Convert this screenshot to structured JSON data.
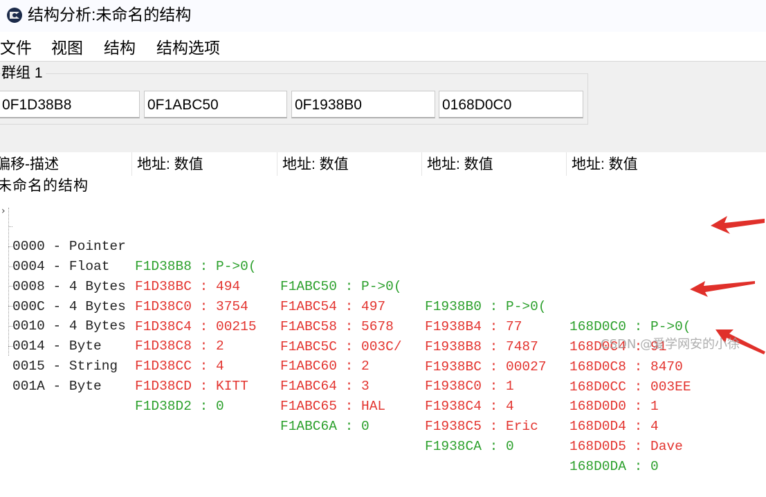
{
  "window": {
    "title": "结构分析:未命名的结构"
  },
  "menu": [
    "文件",
    "视图",
    "结构",
    "结构选项"
  ],
  "group": {
    "label": "群组 1",
    "addresses": [
      "0F1D38B8",
      "0F1ABC50",
      "0F1938B0",
      "0168D0C0"
    ]
  },
  "columns": [
    "偏移-描述",
    "地址: 数值",
    "地址: 数值",
    "地址: 数值",
    "地址: 数值"
  ],
  "root": "未命名的结构",
  "rows": [
    {
      "offset": "0000 - Pointer",
      "color": "green",
      "cells": [
        "F1D38B8 : P->0(",
        "F1ABC50 : P->0(",
        "F1938B0 : P->0(",
        "168D0C0 : P->0("
      ]
    },
    {
      "offset": "0004 - Float",
      "color": "red",
      "cells": [
        "F1D38BC : 494",
        "F1ABC54 : 497",
        "F1938B4 : 77",
        "168D0C4 : 91"
      ]
    },
    {
      "offset": "0008 - 4 Bytes",
      "color": "red",
      "cells": [
        "F1D38C0 : 3754",
        "F1ABC58 : 5678",
        "F1938B8 : 7487",
        "168D0C8 : 8470"
      ]
    },
    {
      "offset": "000C - 4 Bytes",
      "color": "red",
      "cells": [
        "F1D38C4 : 00215",
        "F1ABC5C : 003C/",
        "F1938BC : 00027",
        "168D0CC : 003EE"
      ]
    },
    {
      "offset": "0010 - 4 Bytes",
      "color": "red",
      "cells": [
        "F1D38C8 : 2",
        "F1ABC60 : 2",
        "F1938C0 : 1",
        "168D0D0 : 1"
      ]
    },
    {
      "offset": "0014 - Byte",
      "color": "red",
      "cells": [
        "F1D38CC : 4",
        "F1ABC64 : 3",
        "F1938C4 : 4",
        "168D0D4 : 4"
      ]
    },
    {
      "offset": "0015 - String",
      "color": "red",
      "cells": [
        "F1D38CD : KITT",
        "F1ABC65 : HAL",
        "F1938C5 : Eric",
        "168D0D5 : Dave"
      ]
    },
    {
      "offset": "001A - Byte",
      "color": "green",
      "cells": [
        "F1D38D2 : 0",
        "F1ABC6A : 0",
        "F1938CA : 0",
        "168D0DA : 0"
      ]
    }
  ],
  "watermark": "CSDN @爱学网安的小徐",
  "colors": {
    "green": "#2ca02c",
    "red": "#e3342f",
    "arrow": "#e0302a"
  }
}
